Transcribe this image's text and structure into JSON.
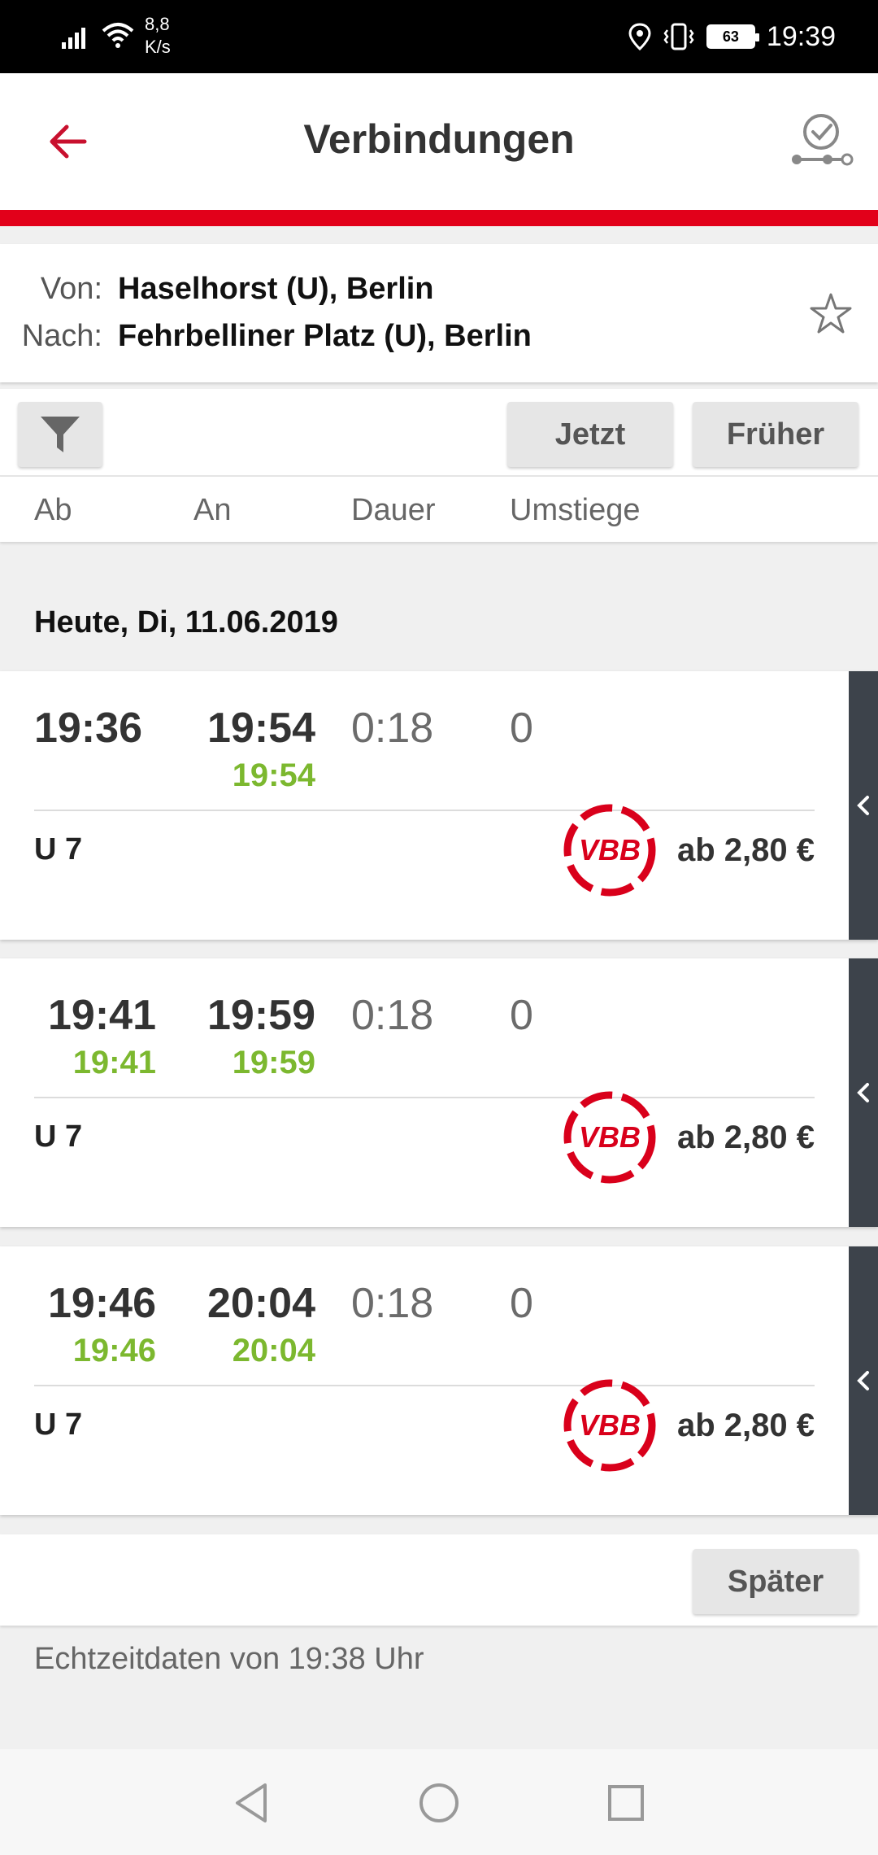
{
  "status_bar": {
    "net_speed": "8,8",
    "net_unit": "K/s",
    "battery": "63",
    "time": "19:39"
  },
  "app_bar": {
    "title": "Verbindungen",
    "back_icon": "arrow-left-icon",
    "connection_check_icon": "check-route-icon"
  },
  "accent_color": "#e2001a",
  "route": {
    "from_label": "Von:",
    "from_value": "Haselhorst (U), Berlin",
    "to_label": "Nach:",
    "to_value": "Fehrbelliner Platz (U), Berlin",
    "favorite_icon": "star-outline-icon"
  },
  "toolbar": {
    "filter_icon": "filter-icon",
    "now_label": "Jetzt",
    "earlier_label": "Früher"
  },
  "columns": {
    "departure": "Ab",
    "arrival": "An",
    "duration": "Dauer",
    "transfers": "Umstiege"
  },
  "date_header": "Heute, Di, 11.06.2019",
  "realtime_color": "#7cb82f",
  "connections": [
    {
      "dep": "19:36",
      "arr": "19:54",
      "dep_rt": "",
      "arr_rt": "19:54",
      "duration": "0:18",
      "transfers": "0",
      "line": "U 7",
      "tariff_logo": "VBB",
      "price": "ab 2,80 €"
    },
    {
      "dep": "19:41",
      "arr": "19:59",
      "dep_rt": "19:41",
      "arr_rt": "19:59",
      "duration": "0:18",
      "transfers": "0",
      "line": "U 7",
      "tariff_logo": "VBB",
      "price": "ab 2,80 €"
    },
    {
      "dep": "19:46",
      "arr": "20:04",
      "dep_rt": "19:46",
      "arr_rt": "20:04",
      "duration": "0:18",
      "transfers": "0",
      "line": "U 7",
      "tariff_logo": "VBB",
      "price": "ab 2,80 €"
    }
  ],
  "later_label": "Später",
  "realtime_note": "Echtzeitdaten von 19:38 Uhr",
  "nav_bar": {
    "back_icon": "nav-back-icon",
    "home_icon": "nav-home-icon",
    "recents_icon": "nav-recents-icon"
  }
}
